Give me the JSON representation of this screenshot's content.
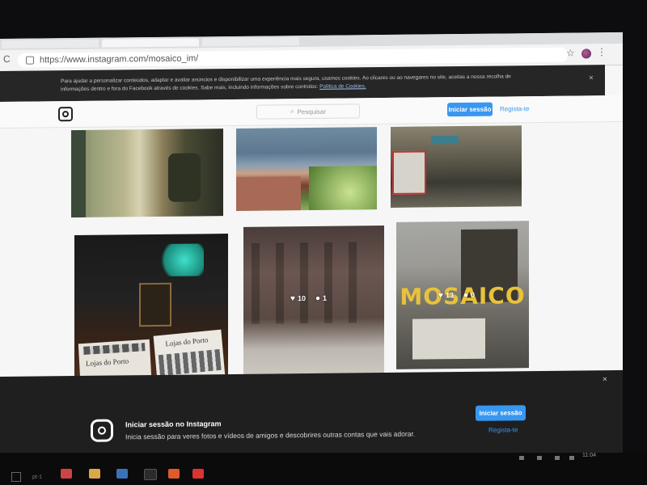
{
  "browser": {
    "url": "https://www.instagram.com/mosaico_im/",
    "nav_reload": "C",
    "star_icon": "star-icon",
    "menu_dots": "⋮"
  },
  "cookie_banner": {
    "text": "Para ajudar a personalizar conteúdos, adaptar e avaliar anúncios e disponibilizar uma experiência mais segura, usamos cookies. Ao clicares ou ao navegares no site, aceitas a nossa recolha de informações dentro e fora do Facebook através de cookies. Sabe mais, incluindo informações sobre controlos:",
    "link": "Política de Cookies.",
    "close": "×"
  },
  "header": {
    "search_placeholder": "Pesquisar",
    "login_button": "Iniciar sessão",
    "register_link": "Regista-te"
  },
  "grid": {
    "photos": [
      {
        "name": "photo-street-building",
        "row": 1,
        "col": 1
      },
      {
        "name": "photo-porto-river-view",
        "row": 1,
        "col": 2
      },
      {
        "name": "photo-tram-street",
        "row": 1,
        "col": 3
      },
      {
        "name": "photo-desk-books",
        "row": 2,
        "col": 1
      },
      {
        "name": "photo-building-facade",
        "row": 2,
        "col": 2,
        "likes": "10",
        "comments": "1"
      },
      {
        "name": "photo-mosaico-logo",
        "row": 2,
        "col": 3,
        "likes": "13",
        "comments": "0",
        "overlay_text": "MOSAICO"
      }
    ],
    "book_title": "Lojas do Porto"
  },
  "login_banner": {
    "title": "Iniciar sessão no Instagram",
    "subtitle": "Inicia sessão para veres fotos e vídeos de amigos e descobrires outras contas que vais adorar.",
    "login_button": "Iniciar sessão",
    "register_link": "Regista-te",
    "close": "×"
  },
  "taskbar": {
    "time": "11:04",
    "label": "pt-1"
  },
  "colors": {
    "accent": "#3897f0",
    "banner_bg": "#262626",
    "mosaico_yellow": "#e9c23a"
  }
}
